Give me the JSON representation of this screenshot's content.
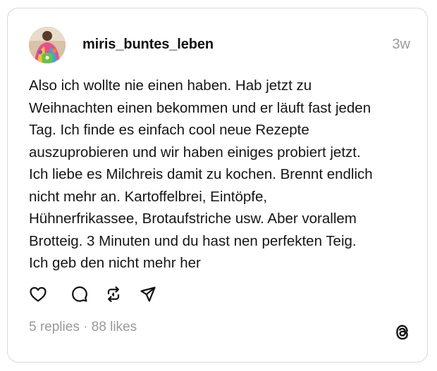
{
  "post": {
    "username": "miris_buntes_leben",
    "timestamp": "3w",
    "text": "Also ich wollte nie einen haben. Hab jetzt zu\nWeihnachten einen bekommen und er läuft fast jeden\nTag. Ich finde es einfach cool neue Rezepte\nauszuprobieren und wir haben einiges probiert jetzt.\nIch liebe es Milchreis damit zu kochen. Brennt endlich\nnicht mehr an. Kartoffelbrei, Eintöpfe,\nHühnerfrikassee, Brotaufstriche usw. Aber vorallem\nBrotteig. 3 Minuten und du hast nen perfekten Teig.\nIch geb den nicht mehr her",
    "stats": "5 replies · 88 likes"
  },
  "actions": {
    "icons": [
      "heart-icon",
      "comment-icon",
      "repost-icon",
      "share-icon"
    ]
  },
  "brand": {
    "logo_icon": "threads-logo-icon"
  },
  "colors": {
    "text": "#151515",
    "muted": "#9a9a9a",
    "border": "#d9d9d9",
    "background": "#ffffff"
  }
}
